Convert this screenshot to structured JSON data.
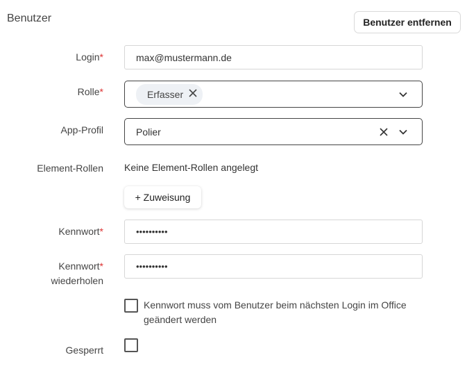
{
  "header": {
    "title": "Benutzer",
    "remove_button": "Benutzer entfernen"
  },
  "form": {
    "login": {
      "label": "Login",
      "required_mark": "*",
      "value": "max@mustermann.de"
    },
    "role": {
      "label": "Rolle",
      "required_mark": "*",
      "chip": "Erfasser"
    },
    "app_profile": {
      "label": "App-Profil",
      "value": "Polier"
    },
    "element_roles": {
      "label": "Element-Rollen",
      "text": "Keine Element-Rollen angelegt",
      "add_button": "+ Zuweisung"
    },
    "password": {
      "label": "Kennwort",
      "required_mark": "*",
      "value": "••••••••••"
    },
    "password_repeat": {
      "label_line1": "Kennwort",
      "required_mark": "*",
      "label_line2": "wiederholen",
      "value": "••••••••••"
    },
    "force_change": {
      "checked": false,
      "text": "Kennwort muss vom Benutzer beim nächsten Login im Office geändert werden"
    },
    "locked": {
      "label": "Gesperrt",
      "checked": false
    }
  },
  "icons": {
    "chip_remove": "close-icon",
    "clear": "close-icon",
    "dropdown": "chevron-down-icon"
  }
}
